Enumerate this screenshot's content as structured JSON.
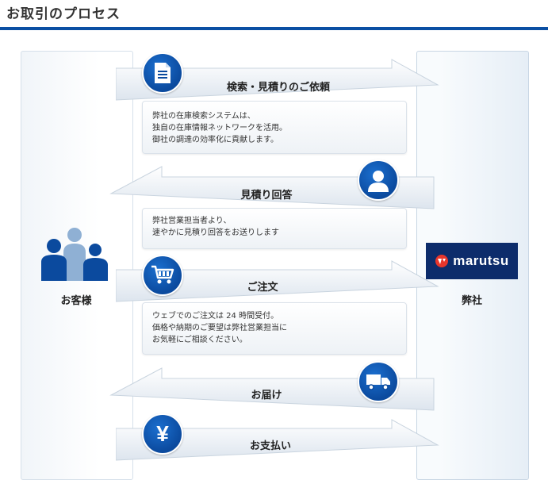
{
  "page_title": "お取引のプロセス",
  "actors": {
    "customer_label": "お客様",
    "company_label": "弊社",
    "company_logo_text": "marutsu"
  },
  "colors": {
    "accent": "#0b4fa3",
    "logo_bg": "#0d2c6b",
    "logo_mark": "#e8362b"
  },
  "steps": [
    {
      "label": "検索・見積りのご依頼",
      "direction": "to-company",
      "icon": "document-icon",
      "description": [
        "弊社の在庫検索システムは、",
        "独自の在庫情報ネットワークを活用。",
        "御社の調達の効率化に貢献します。"
      ]
    },
    {
      "label": "見積り回答",
      "direction": "to-customer",
      "icon": "person-icon",
      "description": [
        "弊社営業担当者より、",
        "速やかに見積り回答をお送りします"
      ]
    },
    {
      "label": "ご注文",
      "direction": "to-company",
      "icon": "cart-icon",
      "description": [
        "ウェブでのご注文は 24 時間受付。",
        "価格や納期のご要望は弊社営業担当に",
        "お気軽にご相談ください。"
      ]
    },
    {
      "label": "お届け",
      "direction": "to-customer",
      "icon": "truck-icon",
      "description": []
    },
    {
      "label": "お支払い",
      "direction": "to-company",
      "icon": "yen-icon",
      "description": []
    }
  ]
}
